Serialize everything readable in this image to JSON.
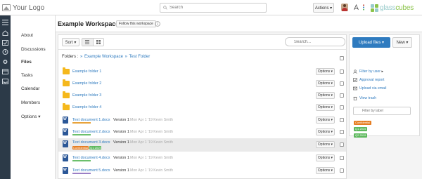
{
  "colors": {
    "accent": "#2f7bbf",
    "folder": "#f5b81c",
    "rail": "#2c3a48",
    "tag_confidential": "#e67e22",
    "tag_q1": "#5cb85c",
    "tag_q2": "#5cb85c",
    "bar_orange": "#e8a33b",
    "bar_green": "#6cc06c",
    "bar_purple": "#9b7fc5"
  },
  "topbar": {
    "logo_text": "Your Logo",
    "search_placeholder": "Search",
    "actions_label": "Actions ▾",
    "brand_text_a": "glass",
    "brand_text_b": "cubes",
    "icons": [
      "avatar",
      "rocket-icon",
      "dots-icon"
    ]
  },
  "rail_icons": [
    "menu-icon",
    "home-icon",
    "check-icon",
    "clock-icon",
    "gear-icon",
    "box-icon",
    "inbox-icon"
  ],
  "nav": {
    "items": [
      {
        "label": "About",
        "active": false
      },
      {
        "label": "Discussions",
        "active": false
      },
      {
        "label": "Files",
        "active": true
      },
      {
        "label": "Tasks",
        "active": false
      },
      {
        "label": "Calendar",
        "active": false
      },
      {
        "label": "Members",
        "active": false
      },
      {
        "label": "Options ▾",
        "active": false
      }
    ]
  },
  "workspace": {
    "title": "Example Workspace",
    "follow_label": "Follow this workspace"
  },
  "toolbar": {
    "sort_label": "Sort ▾",
    "search_placeholder": "Search..."
  },
  "breadcrumb": {
    "prefix": "Folders :",
    "items": [
      "Example Workspace",
      "Test Folder"
    ],
    "sep": "»"
  },
  "rows": [
    {
      "type": "folder",
      "name": "Example folder 1",
      "options": "Options ▾"
    },
    {
      "type": "folder",
      "name": "Example folder 2",
      "options": "Options ▾"
    },
    {
      "type": "folder",
      "name": "Example folder 3",
      "options": "Options ▾"
    },
    {
      "type": "folder",
      "name": "Example folder 4",
      "options": "Options ▾"
    },
    {
      "type": "doc",
      "name": "Text document 1.docx",
      "version": "Version 1",
      "meta": "Mon Apr 1 '19 Kevin Smith",
      "bar": "orange",
      "options": "Options ▾"
    },
    {
      "type": "doc",
      "name": "Text document 2.docx",
      "version": "Version 1",
      "meta": "Mon Apr 1 '19 Kevin Smith",
      "bar": "green",
      "options": "Options ▾"
    },
    {
      "type": "doc",
      "name": "Text document 3.docx",
      "version": "Version 1",
      "meta": "Mon Apr 1 '19 Kevin Smith",
      "tags": [
        "Confidential",
        "Q1 2019"
      ],
      "options": "Options ▾",
      "highlight": true
    },
    {
      "type": "doc",
      "name": "Text document 4.docx",
      "version": "Version 1",
      "meta": "Mon Apr 1 '19 Kevin Smith",
      "bar": "green",
      "options": "Options ▾"
    },
    {
      "type": "doc",
      "name": "Text document 5.docx",
      "version": "Version 1",
      "meta": "Mon Apr 1 '19 Kevin Smith",
      "bar": "purple",
      "options": "Options ▾"
    }
  ],
  "side": {
    "upload_label": "Upload files ▾",
    "new_label": "New ▾",
    "links": [
      "Filter by user",
      "Approval report",
      "Upload via email",
      "View trash"
    ],
    "filter_placeholder": "Filter by label",
    "tags": [
      "Confidential",
      "Q1 2019",
      "Q2 2019"
    ]
  }
}
